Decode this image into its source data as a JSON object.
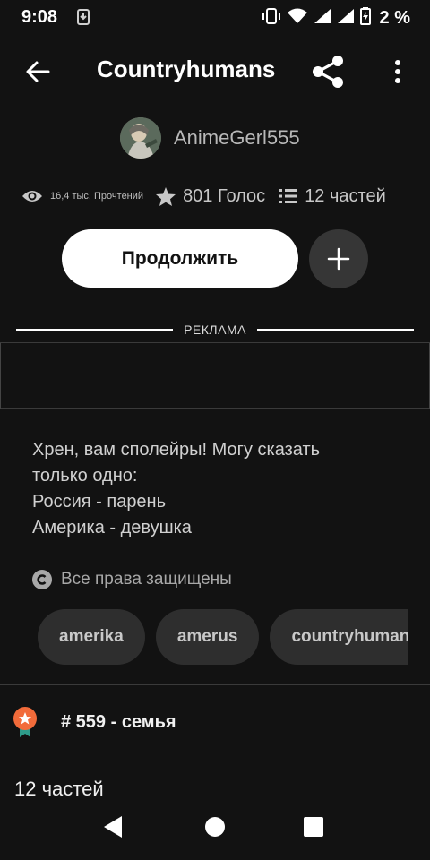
{
  "status_bar": {
    "time": "9:08",
    "battery": "2 %",
    "icons": [
      "download-icon",
      "vibrate-icon",
      "wifi-icon",
      "signal-icon",
      "signal-icon",
      "battery-charging-icon"
    ]
  },
  "toolbar": {
    "title": "Countryhumans",
    "icons": [
      "arrow-left-icon",
      "share-icon",
      "more-vertical-icon"
    ]
  },
  "author": {
    "name": "AnimeGerl555"
  },
  "stats": {
    "reads": "16,4 тыс. Прочтений",
    "votes": "801 Голос",
    "parts": "12 частей"
  },
  "actions": {
    "continue_label": "Продолжить",
    "add_icon": "plus-icon"
  },
  "ad": {
    "label": "РЕКЛАМА"
  },
  "description": {
    "lines": [
      "Хрен, вам сполейры! Могу сказать",
      "только одно:",
      "Россия - парень",
      "Америка - девушка"
    ]
  },
  "copyright": {
    "text": "Все права защищены"
  },
  "tags": [
    "amerika",
    "amerus",
    "countryhumans"
  ],
  "ranking": {
    "text": "# 559 - семья"
  },
  "parts_heading": "12 частей",
  "colors": {
    "background": "#121212",
    "button_primary": "#ffffff",
    "chip": "#2e2e2e",
    "badge": "#f26b3a",
    "ribbon": "#2e9c8a"
  }
}
